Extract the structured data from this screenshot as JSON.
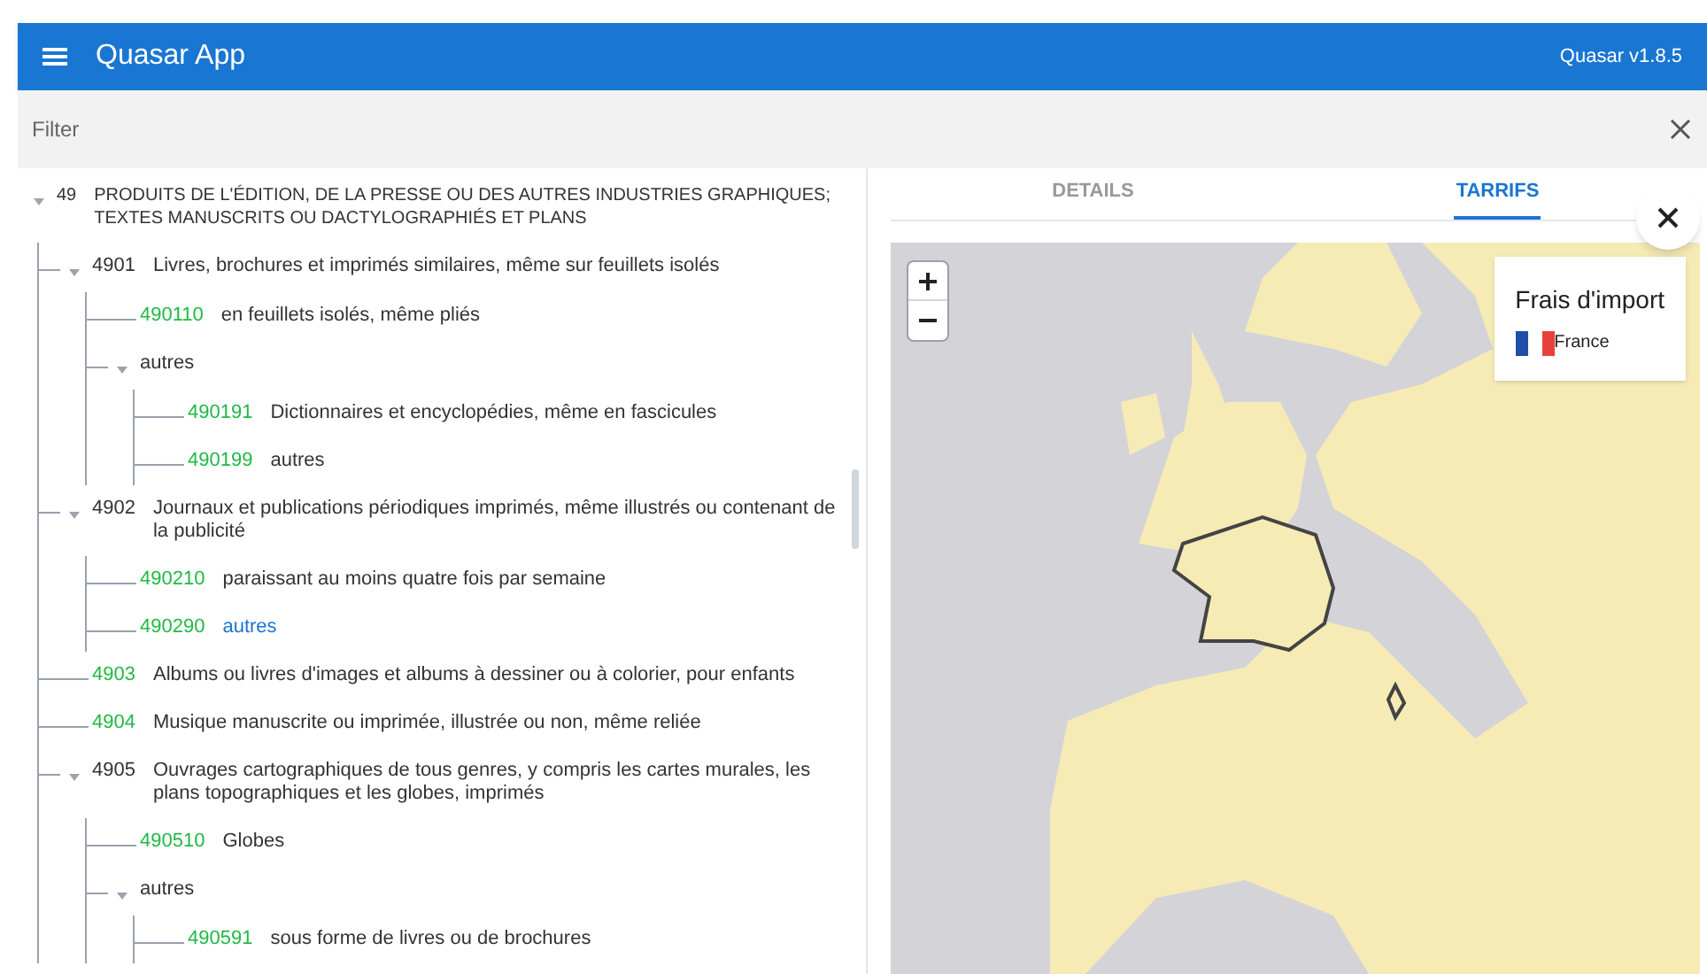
{
  "app_bar": {
    "title": "Quasar App",
    "version": "Quasar v1.8.5"
  },
  "filter": {
    "placeholder": "Filter"
  },
  "tree": [
    {
      "code": "49",
      "label": "PRODUITS DE L'ÉDITION, DE LA PRESSE OU DES AUTRES INDUSTRIES GRAPHIQUES; TEXTES MANUSCRITS OU DACTYLOGRAPHIÉS ET PLANS",
      "expanded": true,
      "selected": false,
      "children": [
        {
          "code": "4901",
          "label": "Livres, brochures et imprimés similaires, même sur feuillets isolés",
          "expanded": true,
          "selected": false,
          "children": [
            {
              "code": "490110",
              "label": "en feuillets isolés, même pliés",
              "selected": false
            },
            {
              "label": "autres",
              "expanded": true,
              "selected": false,
              "children": [
                {
                  "code": "490191",
                  "label": "Dictionnaires et encyclopédies, même en fascicules",
                  "selected": false
                },
                {
                  "code": "490199",
                  "label": "autres",
                  "selected": false
                }
              ]
            }
          ]
        },
        {
          "code": "4902",
          "label": "Journaux et publications périodiques imprimés, même illustrés ou contenant de la publicité",
          "expanded": true,
          "selected": false,
          "children": [
            {
              "code": "490210",
              "label": "paraissant au moins quatre fois par semaine",
              "selected": false
            },
            {
              "code": "490290",
              "label": "autres",
              "selected": true
            }
          ]
        },
        {
          "code": "4903",
          "label": "Albums ou livres d'images et albums à dessiner ou à colorier, pour enfants",
          "selected": false
        },
        {
          "code": "4904",
          "label": "Musique manuscrite ou imprimée, illustrée ou non, même reliée",
          "selected": false
        },
        {
          "code": "4905",
          "label": "Ouvrages cartographiques de tous genres, y compris les cartes murales, les plans topographiques et les globes, imprimés",
          "expanded": true,
          "selected": false,
          "children": [
            {
              "code": "490510",
              "label": "Globes",
              "selected": false
            },
            {
              "label": "autres",
              "expanded": true,
              "selected": false,
              "children": [
                {
                  "code": "490591",
                  "label": "sous forme de livres ou de brochures",
                  "selected": false
                }
              ]
            }
          ]
        }
      ]
    }
  ],
  "tabs": [
    {
      "label": "DETAILS",
      "selected": false
    },
    {
      "label": "TARRIFS",
      "selected": true
    }
  ],
  "map_legend": {
    "title": "Frais d'import",
    "country": "France"
  }
}
